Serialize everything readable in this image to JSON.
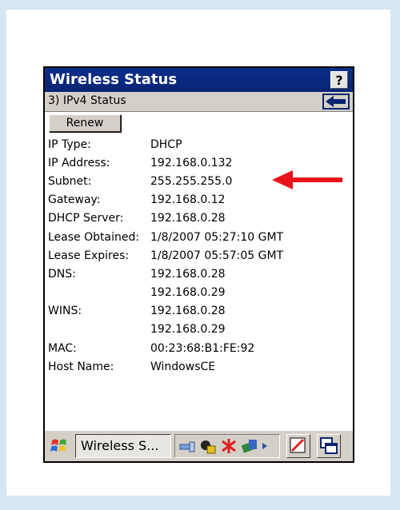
{
  "window": {
    "title": "Wireless Status",
    "help_label": "?"
  },
  "section": {
    "label": "3) IPv4 Status"
  },
  "actions": {
    "renew_label": "Renew"
  },
  "fields": [
    {
      "label": "IP Type:",
      "value": "DHCP"
    },
    {
      "label": "IP Address:",
      "value": "192.168.0.132"
    },
    {
      "label": "Subnet:",
      "value": "255.255.255.0"
    },
    {
      "label": "Gateway:",
      "value": "192.168.0.12"
    },
    {
      "label": "DHCP Server:",
      "value": "192.168.0.28"
    },
    {
      "label": "Lease Obtained:",
      "value": "1/8/2007 05:27:10 GMT"
    },
    {
      "label": "Lease Expires:",
      "value": "1/8/2007 05:57:05 GMT"
    },
    {
      "label": "DNS:",
      "value": "192.168.0.28"
    },
    {
      "label": "",
      "value": "192.168.0.29"
    },
    {
      "label": "WINS:",
      "value": "192.168.0.28"
    },
    {
      "label": "",
      "value": "192.168.0.29"
    },
    {
      "label": "MAC:",
      "value": "00:23:68:B1:FE:92"
    },
    {
      "label": "Host Name:",
      "value": "WindowsCE"
    }
  ],
  "taskbar": {
    "task_label": "Wireless S...",
    "icons": [
      "windows-start-icon",
      "network-icon",
      "lock-icon",
      "wireless-off-icon",
      "connection-icon",
      "tray-arrow-icon",
      "edit-icon",
      "switch-windows-icon"
    ]
  },
  "colors": {
    "titlebar": "#0a2473",
    "page_background": "#d9e6f3",
    "arrow": "#e8141b"
  }
}
